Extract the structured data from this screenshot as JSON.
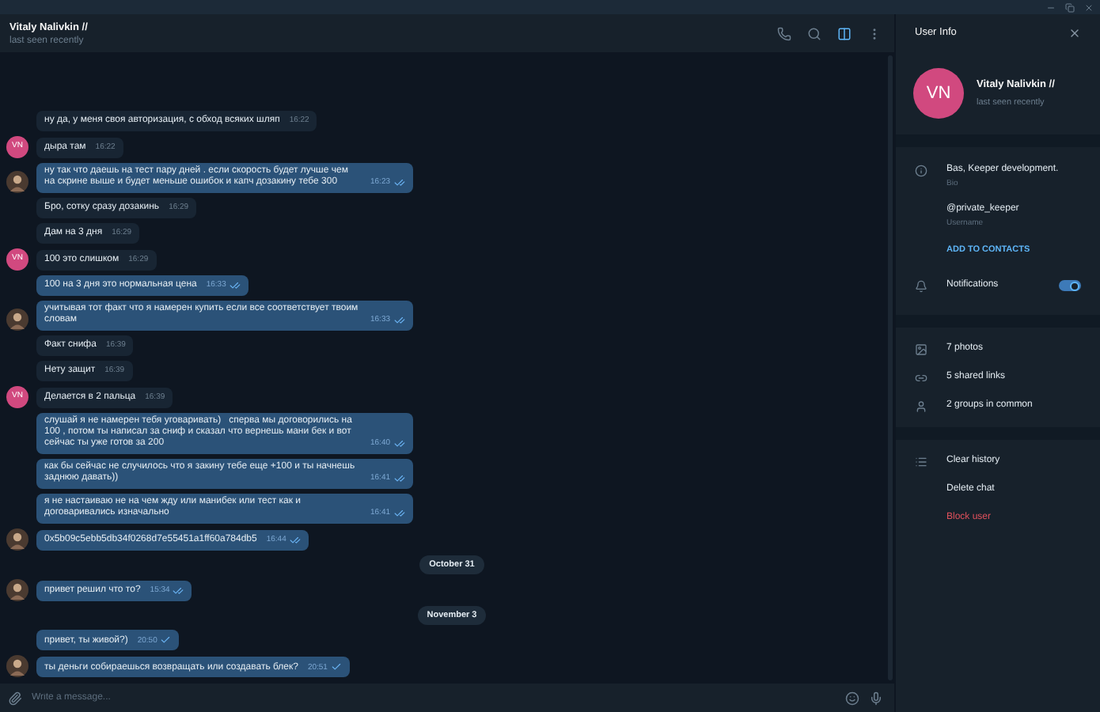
{
  "chat_header": {
    "name": "Vitaly Nalivkin //",
    "status": "last seen recently"
  },
  "header_actions": [
    {
      "kind": "call",
      "active": false
    },
    {
      "kind": "search",
      "active": false
    },
    {
      "kind": "sidebar",
      "active": true
    },
    {
      "kind": "more",
      "active": false
    }
  ],
  "messages": [
    {
      "kind": "message",
      "outgoing": false,
      "text": "ну да, у меня своя авторизация, с обход всяких шляп",
      "time": "16:22",
      "avatar": false
    },
    {
      "kind": "message",
      "outgoing": false,
      "text": "дыра там",
      "time": "16:22",
      "avatar": true,
      "initials": "VN"
    },
    {
      "kind": "message",
      "outgoing": true,
      "text": "ну так что даешь на тест пару дней . если скорость будет лучше чем на скрине выше и будет меньше ошибок и капч дозакину тебе 300",
      "time": "16:23",
      "read": true,
      "avatar": true
    },
    {
      "kind": "message",
      "outgoing": false,
      "text": "Бро, сотку сразу дозакинь",
      "time": "16:29",
      "avatar": false
    },
    {
      "kind": "message",
      "outgoing": false,
      "text": "Дам на 3 дня",
      "time": "16:29",
      "avatar": false
    },
    {
      "kind": "message",
      "outgoing": false,
      "text": "100 это слишком",
      "time": "16:29",
      "avatar": true,
      "initials": "VN"
    },
    {
      "kind": "message",
      "outgoing": true,
      "text": "100 на 3 дня это нормальная цена",
      "time": "16:33",
      "read": true,
      "avatar": false
    },
    {
      "kind": "message",
      "outgoing": true,
      "text": "учитывая тот факт что я намерен купить если все соответствует твоим словам",
      "time": "16:33",
      "read": true,
      "avatar": true
    },
    {
      "kind": "message",
      "outgoing": false,
      "text": "Факт снифа",
      "time": "16:39",
      "avatar": false
    },
    {
      "kind": "message",
      "outgoing": false,
      "text": "Нету защит",
      "time": "16:39",
      "avatar": false
    },
    {
      "kind": "message",
      "outgoing": false,
      "text": "Делается в 2 пальца",
      "time": "16:39",
      "avatar": true,
      "initials": "VN"
    },
    {
      "kind": "message",
      "outgoing": true,
      "text": "слушай я не намерен тебя уговаривать)   сперва мы договорились на 100 , потом ты написал за сниф и сказал что вернешь мани бек и вот сейчас ты уже готов за 200",
      "time": "16:40",
      "read": true,
      "avatar": false
    },
    {
      "kind": "message",
      "outgoing": true,
      "text": "как бы сейчас не случилось что я закину тебе еще +100 и ты начнешь заднюю давать))",
      "time": "16:41",
      "read": true,
      "avatar": false
    },
    {
      "kind": "message",
      "outgoing": true,
      "text": "я не настаиваю не на чем жду или манибек или тест как и договаривались изначально",
      "time": "16:41",
      "read": true,
      "avatar": false
    },
    {
      "kind": "message",
      "outgoing": true,
      "text": "0x5b09c5ebb5db34f0268d7e55451a1ff60a784db5",
      "time": "16:44",
      "read": true,
      "avatar": true
    },
    {
      "kind": "date",
      "text": "October 31"
    },
    {
      "kind": "message",
      "outgoing": true,
      "text": "привет решил что то?",
      "time": "15:34",
      "read": true,
      "avatar": true
    },
    {
      "kind": "date",
      "text": "November 3"
    },
    {
      "kind": "message",
      "outgoing": true,
      "text": "привет, ты живой?)",
      "time": "20:50",
      "read": false,
      "avatar": false
    },
    {
      "kind": "message",
      "outgoing": true,
      "text": "ты деньги собираешься возвращать или создавать блек?",
      "time": "20:51",
      "read": false,
      "avatar": true
    }
  ],
  "composer": {
    "placeholder": "Write a message..."
  },
  "user_info": {
    "title": "User Info",
    "initials": "VN",
    "name": "Vitaly Nalivkin //",
    "status": "last seen recently",
    "bio": {
      "value": "Bas, Keeper development.",
      "label": "Bio"
    },
    "username": {
      "value": "@private_keeper",
      "label": "Username"
    },
    "add_contact": "ADD TO CONTACTS",
    "notifications": {
      "label": "Notifications",
      "on": true
    },
    "media": [
      {
        "kind": "photos",
        "label": "7 photos"
      },
      {
        "kind": "links",
        "label": "5 shared links"
      },
      {
        "kind": "groups",
        "label": "2 groups in common"
      }
    ],
    "actions": [
      {
        "label": "Clear history",
        "danger": false,
        "icon": true
      },
      {
        "label": "Delete chat",
        "danger": false,
        "icon": false
      },
      {
        "label": "Block user",
        "danger": true,
        "icon": false
      }
    ]
  }
}
